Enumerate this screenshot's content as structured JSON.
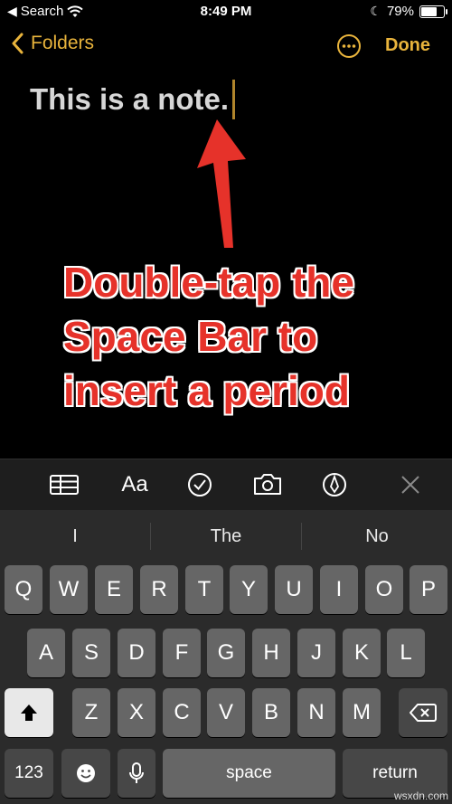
{
  "status": {
    "back_app": "Search",
    "time": "8:49 PM",
    "battery": "79%",
    "battery_level": 0.79
  },
  "nav": {
    "back_label": "Folders",
    "done_label": "Done"
  },
  "note": {
    "text": "This is a note."
  },
  "annotation": {
    "lines": [
      "Double-tap the",
      "Space Bar to",
      "insert a period"
    ]
  },
  "toolbar": {
    "format_label": "Aa"
  },
  "suggestions": [
    "I",
    "The",
    "No"
  ],
  "keys": {
    "row1": [
      "Q",
      "W",
      "E",
      "R",
      "T",
      "Y",
      "U",
      "I",
      "O",
      "P"
    ],
    "row2": [
      "A",
      "S",
      "D",
      "F",
      "G",
      "H",
      "J",
      "K",
      "L"
    ],
    "row3": [
      "Z",
      "X",
      "C",
      "V",
      "B",
      "N",
      "M"
    ],
    "numbers_label": "123",
    "space_label": "space",
    "return_label": "return"
  },
  "watermark": "wsxdn.com",
  "colors": {
    "accent": "#e9b43c",
    "annotation": "#e6322a",
    "caret": "#b0852c"
  }
}
